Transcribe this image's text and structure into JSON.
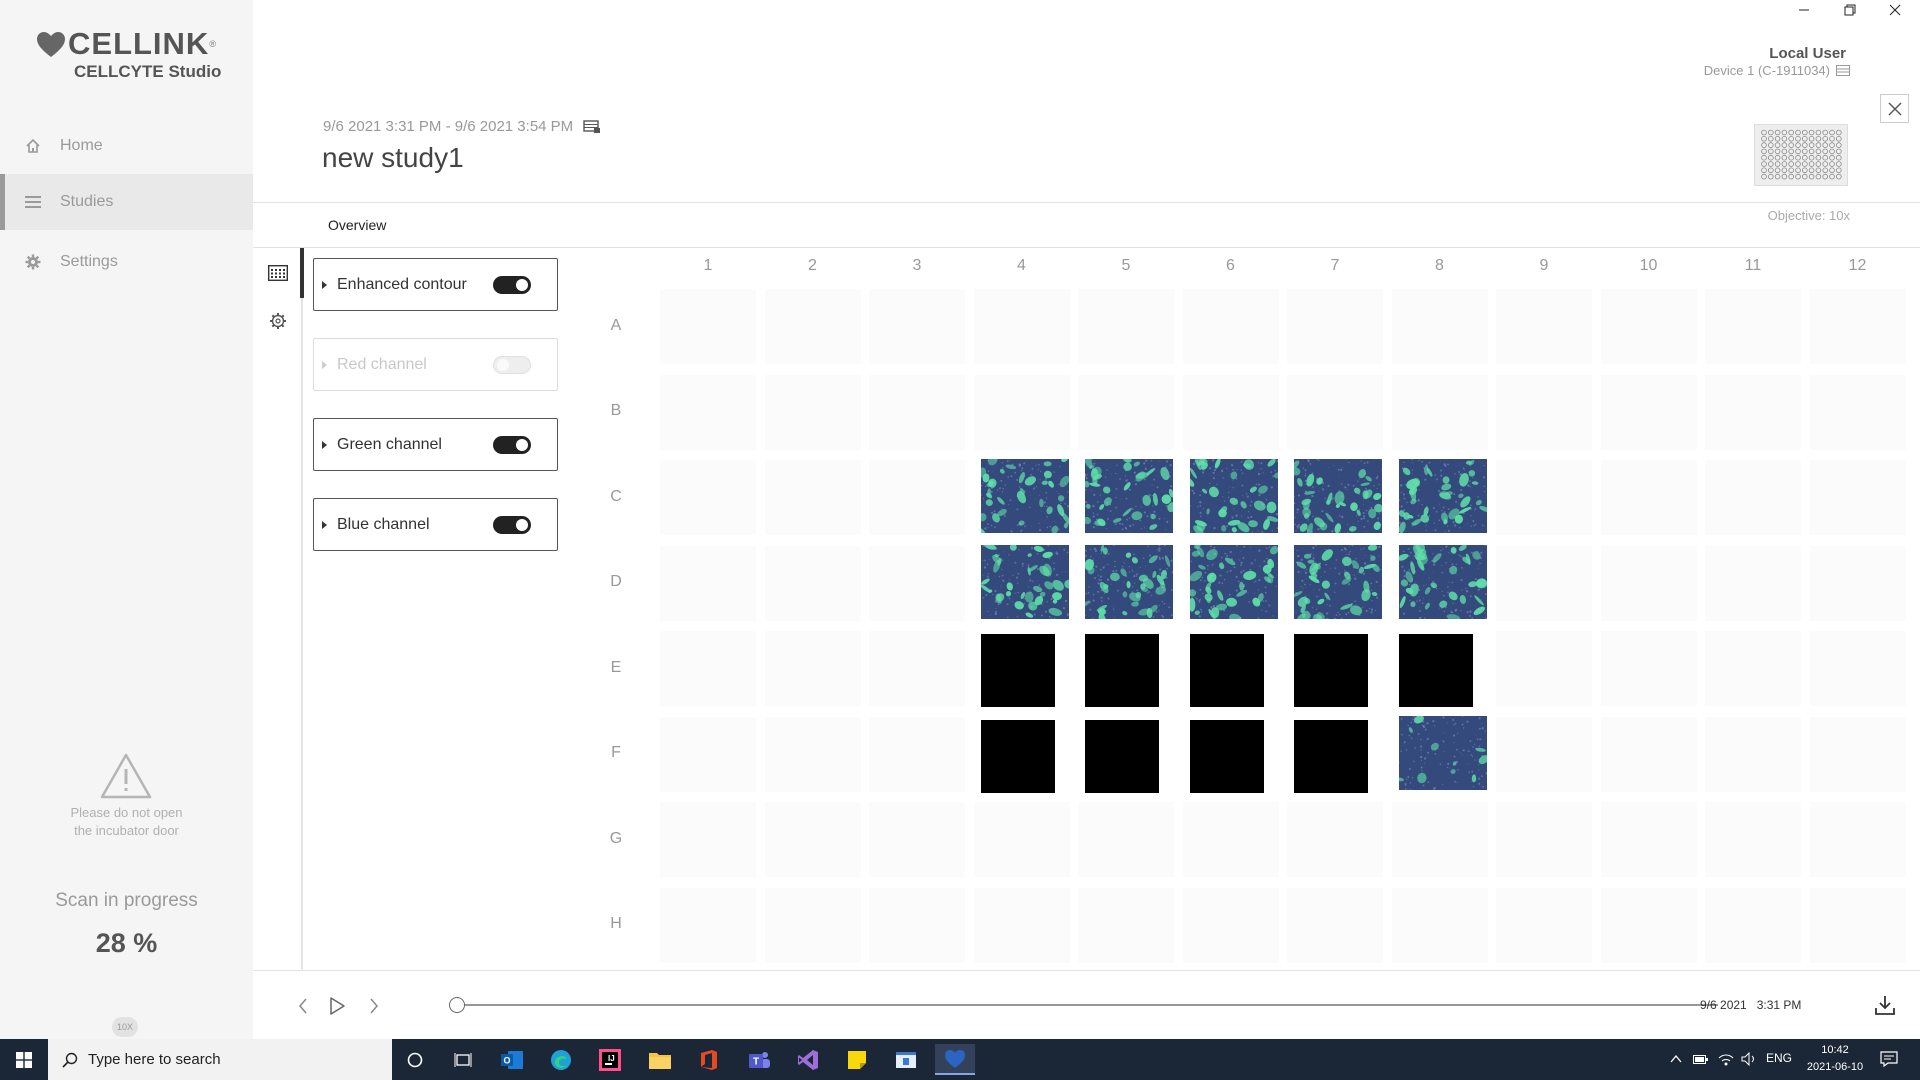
{
  "app": {
    "logo_text": "CELLINK",
    "logo_reg": "®",
    "subtitle": "CELLCYTE Studio"
  },
  "sidebar": {
    "items": [
      {
        "label": "Home",
        "icon": "home-icon"
      },
      {
        "label": "Studies",
        "icon": "list-icon",
        "active": true
      },
      {
        "label": "Settings",
        "icon": "gear-icon"
      }
    ],
    "warning_line1": "Please do not open",
    "warning_line2": "the incubator door",
    "scan_label": "Scan in progress",
    "scan_percent": "28 %",
    "zoom_badge": "10X"
  },
  "header": {
    "user": "Local User",
    "device": "Device 1 (C-1911034)",
    "date_range": "9/6 2021 3:31 PM - 9/6 2021 3:54 PM",
    "title": "new study1",
    "tab_overview": "Overview",
    "objective": "Objective: 10x"
  },
  "channels": [
    {
      "label": "Enhanced contour",
      "enabled": true,
      "on": true
    },
    {
      "label": "Red channel",
      "enabled": false,
      "on": false
    },
    {
      "label": "Green channel",
      "enabled": true,
      "on": true
    },
    {
      "label": "Blue channel",
      "enabled": true,
      "on": true
    }
  ],
  "plate": {
    "columns": [
      "1",
      "2",
      "3",
      "4",
      "5",
      "6",
      "7",
      "8",
      "9",
      "10",
      "11",
      "12"
    ],
    "rows": [
      "A",
      "B",
      "C",
      "D",
      "E",
      "F",
      "G",
      "H"
    ],
    "imaged_wells": [
      "C4",
      "C5",
      "C6",
      "C7",
      "C8",
      "D4",
      "D5",
      "D6",
      "D7",
      "D8",
      "F8"
    ],
    "black_wells": [
      "E4",
      "E5",
      "E6",
      "E7",
      "E8",
      "F4",
      "F5",
      "F6",
      "F7"
    ]
  },
  "timeline": {
    "timestamp": "9/6 2021   3:31 PM",
    "position": 0.0
  },
  "taskbar": {
    "search_placeholder": "Type here to search",
    "language": "ENG",
    "time": "10:42",
    "date": "2021-06-10"
  },
  "colors": {
    "sidebar_bg": "#f5f5f5",
    "taskbar_bg": "#1b2637",
    "well_image_base": "#2e4476",
    "cell_green": "#5fe0a8"
  }
}
